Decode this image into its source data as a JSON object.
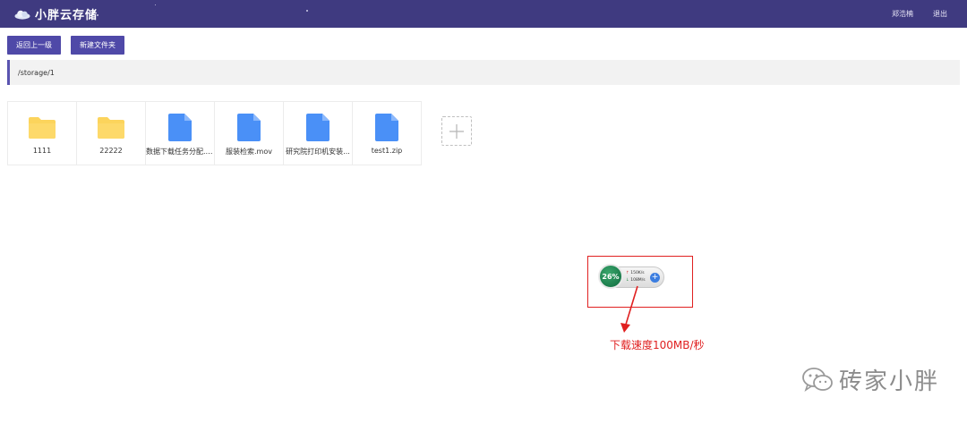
{
  "header": {
    "app_title": "小胖云存储",
    "user_name": "郑浩楠",
    "logout": "退出",
    "colors": {
      "background": "#3f3a80",
      "text": "#ffffff"
    }
  },
  "toolbar": {
    "back_label": "返回上一级",
    "new_folder_label": "新建文件夹",
    "button_color": "#4f49a8"
  },
  "breadcrumb": {
    "path": "/storage/1",
    "accent": "#5a54b0"
  },
  "files": [
    {
      "name": "1111",
      "type": "folder",
      "icon": "folder-icon"
    },
    {
      "name": "22222",
      "type": "folder",
      "icon": "folder-icon"
    },
    {
      "name": "数据下载任务分配.zip",
      "type": "file",
      "icon": "file-icon"
    },
    {
      "name": "服装检索.mov",
      "type": "file",
      "icon": "file-icon"
    },
    {
      "name": "研究院打印机安装...",
      "type": "file",
      "icon": "file-icon"
    },
    {
      "name": "test1.zip",
      "type": "file",
      "icon": "file-icon"
    }
  ],
  "colors": {
    "folder": "#fcd45c",
    "file": "#4a90f7",
    "annotation": "#e02020"
  },
  "speed_widget": {
    "percent": "26%",
    "upload_rate": "150K/s",
    "download_rate": "108M/s",
    "up_arrow": "↑",
    "down_arrow": "↓"
  },
  "annotation": {
    "caption": "下载速度100MB/秒"
  },
  "watermark": {
    "text": "砖家小胖"
  }
}
